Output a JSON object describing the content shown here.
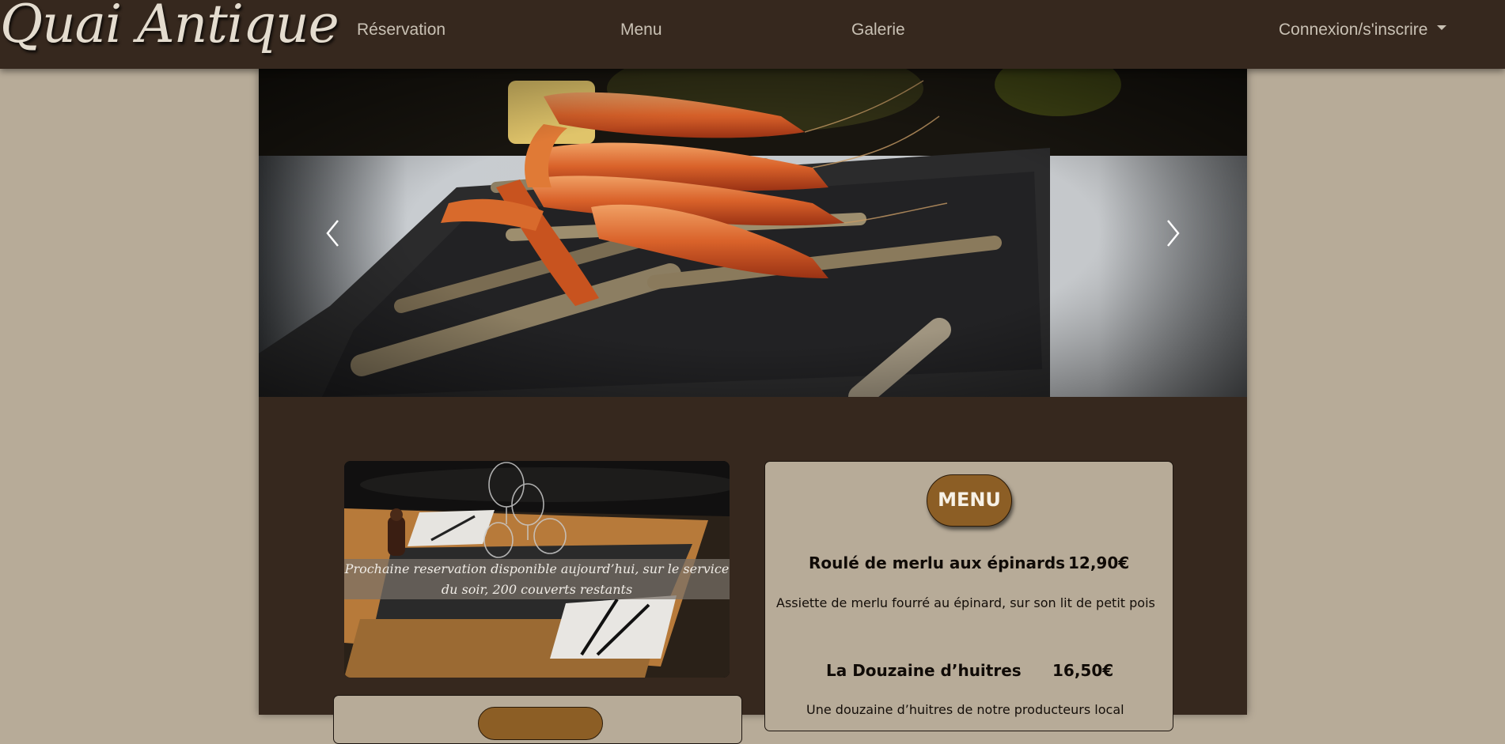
{
  "navbar": {
    "brand": "Quai Antique",
    "links": [
      "Réservation",
      "Menu",
      "Galerie"
    ],
    "account_label": "Connexion/s'inscrire"
  },
  "carousel": {
    "prev_icon": "chevron-left-icon",
    "next_icon": "chevron-right-icon"
  },
  "reservation_card": {
    "caption": "Prochaine reservation disponible aujourd’hui, sur le service du soir, 200 couverts restants"
  },
  "menu_card": {
    "button_label": "MENU",
    "dishes": [
      {
        "name": "Roulé de merlu aux épinards",
        "price": "12,90€",
        "description": "Assiette de merlu fourré au épinard, sur son lit de petit pois"
      },
      {
        "name": "La Douzaine d’huitres",
        "price": "16,50€",
        "description": "Une douzaine d’huitres de notre producteurs local"
      }
    ]
  },
  "colors": {
    "navbar_bg": "#36281e",
    "page_bg": "#b7ab98",
    "accent_button": "#8c5e25",
    "nav_text": "#c9c1b4"
  }
}
